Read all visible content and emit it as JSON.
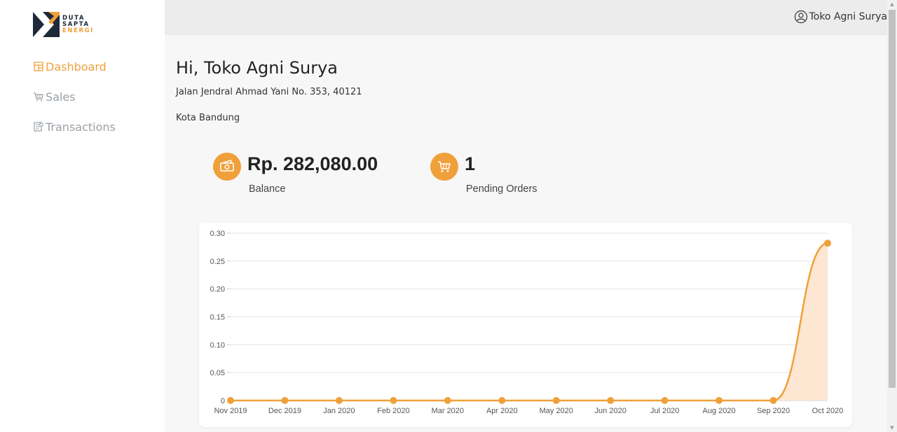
{
  "brand": {
    "line1": "DUTA",
    "line2": "SAPTA",
    "line3": "ENERGI",
    "accent_color": "#f0a03a",
    "dark_color": "#1f2a38"
  },
  "sidebar": {
    "items": [
      {
        "label": "Dashboard",
        "icon": "dashboard-icon",
        "active": true
      },
      {
        "label": "Sales",
        "icon": "cart-icon",
        "active": false
      },
      {
        "label": "Transactions",
        "icon": "receipt-icon",
        "active": false
      }
    ]
  },
  "header": {
    "user_name": "Toko Agni Surya",
    "user_icon": "user-circle-icon"
  },
  "main": {
    "greeting": "Hi, Toko Agni Surya",
    "address": "Jalan Jendral Ahmad Yani No. 353, 40121",
    "city": "Kota Bandung",
    "stats": {
      "balance_value": "Rp. 282,080.00",
      "balance_label": "Balance",
      "balance_icon": "money-icon",
      "pending_value": "1",
      "pending_label": "Pending Orders",
      "pending_icon": "cart-icon"
    }
  },
  "chart_data": {
    "type": "area",
    "categories": [
      "Nov 2019",
      "Dec 2019",
      "Jan 2020",
      "Feb 2020",
      "Mar 2020",
      "Apr 2020",
      "May 2020",
      "Jun 2020",
      "Jul 2020",
      "Aug 2020",
      "Sep 2020",
      "Oct 2020"
    ],
    "series": [
      {
        "values": [
          0,
          0,
          0,
          0,
          0,
          0,
          0,
          0,
          0,
          0,
          0,
          0.282
        ]
      }
    ],
    "ylim": [
      0,
      0.3
    ],
    "yticks": [
      "0",
      "0.05",
      "0.10",
      "0.15",
      "0.20",
      "0.25",
      "0.30"
    ],
    "grid": true,
    "line_color": "#f0a03a",
    "fill_color": "#fde6d2"
  }
}
